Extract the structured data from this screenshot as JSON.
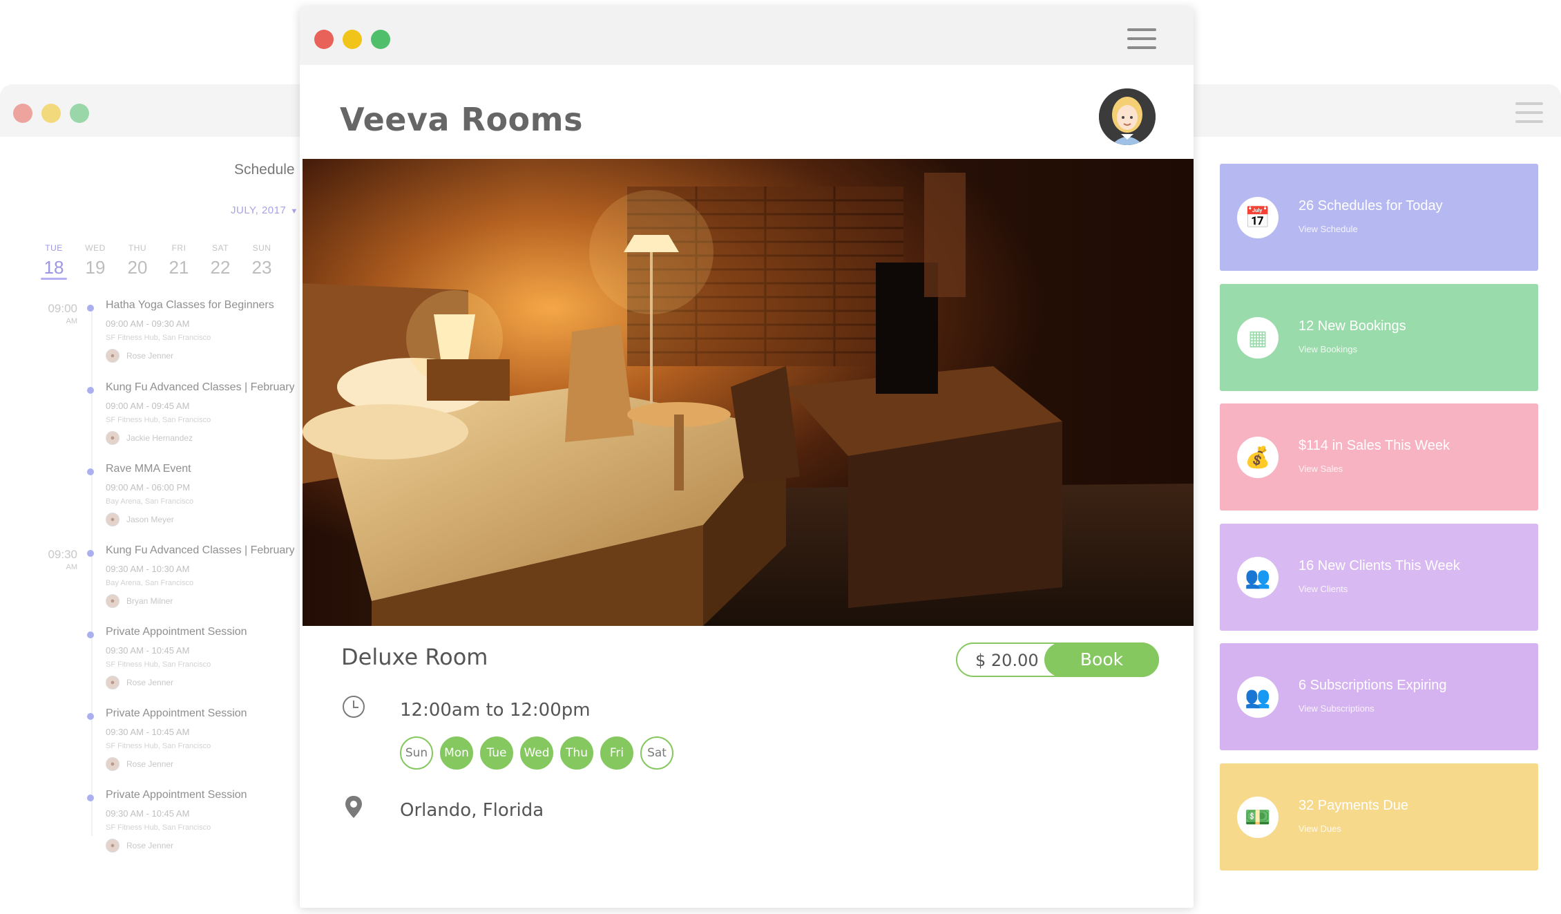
{
  "colors": {
    "accent_green": "#86c860",
    "schedule_accent": "#9b97e6",
    "window_red": "#e8625a",
    "window_yellow": "#f0c419",
    "window_green": "#4fbf6c"
  },
  "front_window": {
    "app_title": "Veeva Rooms",
    "menu_icon": "hamburger-icon",
    "avatar_icon": "user-avatar"
  },
  "room": {
    "name": "Deluxe Room",
    "price": "$ 20.00",
    "book_label": "Book",
    "hours": "12:00am to 12:00pm",
    "days": [
      {
        "label": "Sun",
        "active": false
      },
      {
        "label": "Mon",
        "active": true
      },
      {
        "label": "Tue",
        "active": true
      },
      {
        "label": "Wed",
        "active": true
      },
      {
        "label": "Thu",
        "active": true
      },
      {
        "label": "Fri",
        "active": true
      },
      {
        "label": "Sat",
        "active": false
      }
    ],
    "location": "Orlando, Florida",
    "clock_icon": "clock-icon",
    "location_icon": "map-pin-icon"
  },
  "schedule": {
    "title": "Schedule",
    "month": "JULY, 2017",
    "days": [
      {
        "name": "TUE",
        "date": "18",
        "active": true
      },
      {
        "name": "WED",
        "date": "19",
        "active": false
      },
      {
        "name": "THU",
        "date": "20",
        "active": false
      },
      {
        "name": "FRI",
        "date": "21",
        "active": false
      },
      {
        "name": "SAT",
        "date": "22",
        "active": false
      },
      {
        "name": "SUN",
        "date": "23",
        "active": false
      }
    ],
    "time_slots": [
      {
        "time": "09:00",
        "ampm": "AM"
      },
      {
        "time": "09:30",
        "ampm": "AM"
      }
    ],
    "events": [
      {
        "title": "Hatha Yoga Classes for Beginners",
        "time": "09:00 AM - 09:30 AM",
        "location": "SF Fitness Hub, San Francisco",
        "person": "Rose Jenner"
      },
      {
        "title": "Kung Fu Advanced Classes | February",
        "time": "09:00 AM - 09:45 AM",
        "location": "SF Fitness Hub, San Francisco",
        "person": "Jackie Hernandez"
      },
      {
        "title": "Rave MMA Event",
        "time": "09:00 AM - 06:00 PM",
        "location": "Bay Arena, San Francisco",
        "person": "Jason Meyer"
      },
      {
        "title": "Kung Fu Advanced Classes | February",
        "time": "09:30 AM - 10:30 AM",
        "location": "Bay Arena, San Francisco",
        "person": "Bryan Milner"
      },
      {
        "title": "Private Appointment Session",
        "time": "09:30 AM - 10:45 AM",
        "location": "SF Fitness Hub, San Francisco",
        "person": "Rose Jenner"
      },
      {
        "title": "Private Appointment Session",
        "time": "09:30 AM - 10:45 AM",
        "location": "SF Fitness Hub, San Francisco",
        "person": "Rose Jenner"
      },
      {
        "title": "Private Appointment Session",
        "time": "09:30 AM - 10:45 AM",
        "location": "SF Fitness Hub, San Francisco",
        "person": "Rose Jenner"
      }
    ]
  },
  "cards": [
    {
      "title": "26 Schedules for Today",
      "link": "View Schedule",
      "color": "#b6b8f2",
      "icon": "calendar-icon",
      "glyph": "📅"
    },
    {
      "title": "12 New Bookings",
      "link": "View Bookings",
      "color": "#9adbab",
      "icon": "grid-icon",
      "glyph": "▦"
    },
    {
      "title": "$114 in Sales This Week",
      "link": "View Sales",
      "color": "#f7b3c2",
      "icon": "money-bag-icon",
      "glyph": "💰"
    },
    {
      "title": "16 New Clients This Week",
      "link": "View Clients",
      "color": "#d8b9f1",
      "icon": "users-icon",
      "glyph": "👥"
    },
    {
      "title": "6 Subscriptions Expiring",
      "link": "View Subscriptions",
      "color": "#d5b3f0",
      "icon": "users-icon",
      "glyph": "👥"
    },
    {
      "title": "32 Payments Due",
      "link": "View Dues",
      "color": "#f7d98c",
      "icon": "cash-icon",
      "glyph": "💵"
    }
  ]
}
